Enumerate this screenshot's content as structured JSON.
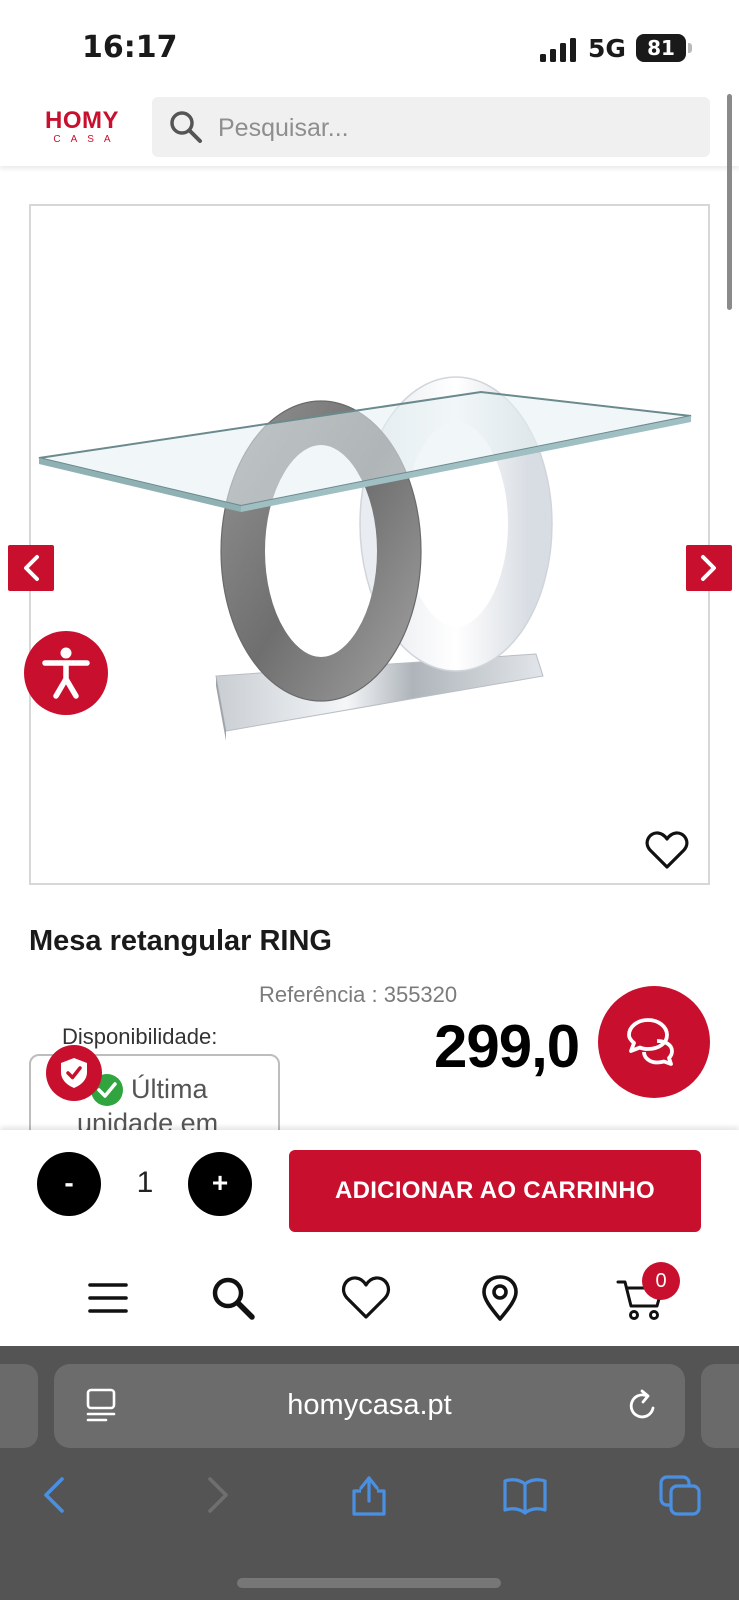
{
  "status_bar": {
    "time": "16:17",
    "network": "5G",
    "battery": "81"
  },
  "header": {
    "logo_main": "HOMY",
    "logo_sub": "CASA",
    "search_placeholder": "Pesquisar..."
  },
  "product": {
    "title": "Mesa retangular RING",
    "reference": "Referência : 355320",
    "availability_label": "Disponibilidade:",
    "availability_line1": "Última",
    "availability_line2": "unidade em",
    "price": "299,0"
  },
  "cart_bar": {
    "minus_label": "-",
    "quantity": "1",
    "plus_label": "+",
    "add_to_cart_label": "ADICIONAR AO CARRINHO"
  },
  "bottom_nav": {
    "items": [
      "menu-icon",
      "search-icon",
      "heart-icon",
      "location-pin-icon",
      "cart-icon"
    ],
    "cart_count": "0"
  },
  "browser": {
    "url": "homycasa.pt"
  },
  "colors": {
    "brand_red": "#c8102e",
    "success_green": "#2fa43f",
    "browser_chrome": "#545454",
    "browser_blue": "#4a90e2"
  }
}
